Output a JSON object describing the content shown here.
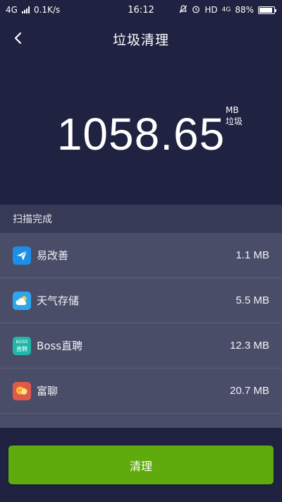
{
  "status_bar": {
    "network": "4G",
    "speed": "0.1K/s",
    "time": "16:12",
    "right_text": "HD",
    "network_right": "4G",
    "battery": "88%",
    "battery_level": 0.88
  },
  "header": {
    "title": "垃圾清理",
    "back_icon": "chevron-left-icon"
  },
  "summary": {
    "value": "1058.65",
    "unit": "MB",
    "unit_label": "垃圾"
  },
  "section": {
    "label": "扫描完成"
  },
  "apps": [
    {
      "name": "易改善",
      "size": "1.1 MB",
      "icon": "paper-plane-icon",
      "color": "#1c8ee6"
    },
    {
      "name": "天气存储",
      "size": "5.5 MB",
      "icon": "weather-cloud-icon",
      "color": "#2ea6ee"
    },
    {
      "name": "Boss直聘",
      "size": "12.3 MB",
      "icon": "boss-logo-icon",
      "color": "#20b7aa",
      "icon_text_top": "BOSS",
      "icon_text_bottom": "直聘"
    },
    {
      "name": "富聊",
      "size": "20.7 MB",
      "icon": "chat-bubble-icon",
      "color": "#e05a4a"
    }
  ],
  "footer": {
    "clean_label": "清理"
  },
  "colors": {
    "background": "#1f2240",
    "section": "#373a56",
    "list": "#4a4d68",
    "button": "#5faa0c"
  }
}
